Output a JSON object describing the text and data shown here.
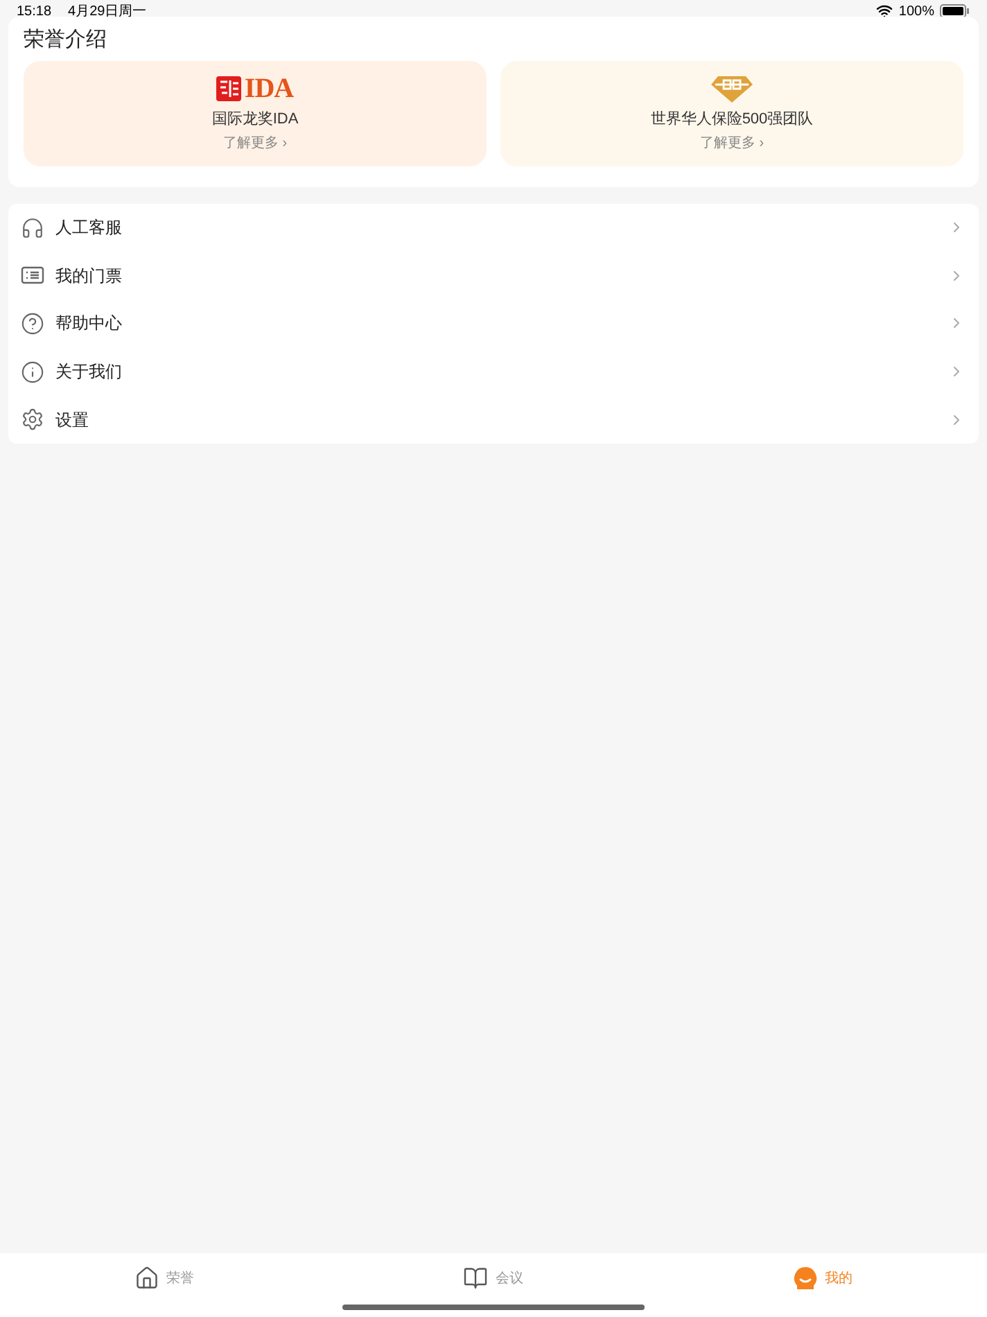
{
  "status_bar": {
    "time": "15:18",
    "date": "4月29日周一",
    "battery": "100%"
  },
  "honors": {
    "title": "荣誉介绍",
    "cards": [
      {
        "kind": "ida",
        "logo_text": "IDA",
        "name": "国际龙奖IDA",
        "link": "了解更多 ›",
        "color": "#fff1e6"
      },
      {
        "kind": "diamond",
        "name": "世界华人保险500强团队",
        "link": "了解更多 ›",
        "color": "#fef7ec"
      }
    ]
  },
  "menu": [
    {
      "kind": "headset",
      "label": "人工客服"
    },
    {
      "kind": "ticket",
      "label": "我的门票"
    },
    {
      "kind": "help",
      "label": "帮助中心"
    },
    {
      "kind": "info",
      "label": "关于我们"
    },
    {
      "kind": "settings",
      "label": "设置"
    }
  ],
  "tabs": [
    {
      "kind": "home",
      "label": "荣誉",
      "selected": false
    },
    {
      "kind": "book",
      "label": "会议",
      "selected": false
    },
    {
      "kind": "me",
      "label": "我的",
      "selected": true
    }
  ]
}
